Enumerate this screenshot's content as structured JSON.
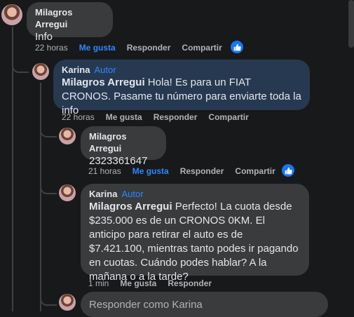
{
  "comments": [
    {
      "author": "Milagros Arregui",
      "text": "Info",
      "actions": {
        "time": "22 horas",
        "like": "Me gusta",
        "reply": "Responder",
        "share": "Compartir"
      }
    },
    {
      "author": "Karina",
      "badge": "Autor",
      "mention": "Milagros Arregui",
      "text": " Hola! Es para un FIAT CRONOS. Pasame tu número para enviarte toda la info",
      "actions": {
        "time": "22 horas",
        "like": "Me gusta",
        "reply": "Responder",
        "share": "Compartir"
      }
    },
    {
      "author": "Milagros Arregui",
      "text": "2323361647",
      "actions": {
        "time": "21 horas",
        "like": "Me gusta",
        "reply": "Responder",
        "share": "Compartir"
      }
    },
    {
      "author": "Karina",
      "badge": "Autor",
      "mention": "Milagros Arregui",
      "text": " Perfecto! La cuota desde $235.000 es de un CRONOS 0KM. El anticipo para retirar el auto es de $7.421.100, mientras tanto podes ir pagando en cuotas. Cuándo podes hablar? A la mañana o a la tarde?",
      "actions": {
        "time": "1 min",
        "like": "Me gusta",
        "reply": "Responder"
      }
    }
  ],
  "reply_box": {
    "placeholder": "Responder como Karina"
  },
  "colors": {
    "accent": "#2d88ff",
    "bubble": "#3a3b3c",
    "author_bubble": "#263951",
    "background": "#18191a"
  }
}
